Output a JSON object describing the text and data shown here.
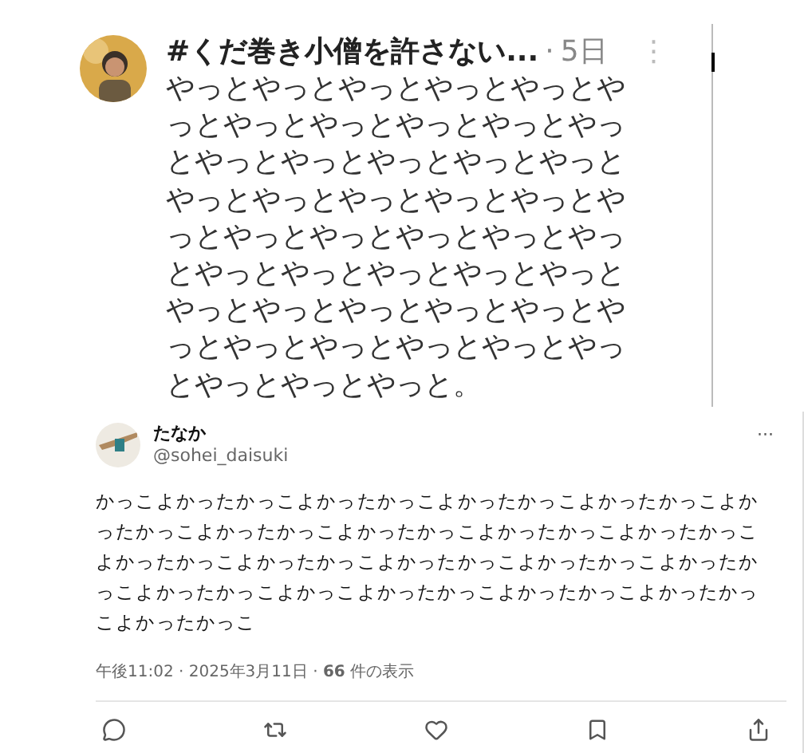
{
  "posts": [
    {
      "name": "#くだ巻き小僧を許さない...",
      "separator": "·",
      "time": "5日",
      "menu": "⋮",
      "text_lines": [
        "やっとやっとやっとやっとやっとや",
        "っとやっとやっとやっとやっとやっ",
        "とやっとやっとやっとやっとやっと",
        "やっとやっとやっとやっとやっとや",
        "っとやっとやっとやっとやっとやっ",
        "とやっとやっとやっとやっとやっと",
        "やっとやっとやっとやっとやっとや",
        "っとやっとやっとやっとやっとやっ",
        "とやっとやっとやっと。"
      ]
    },
    {
      "name": "たなか",
      "handle": "@sohei_daisuki",
      "menu": "···",
      "text_lines": [
        "かっこよかったかっこよかったかっこよかったかっこよかったかっこよか",
        "ったかっこよかったかっこよかったかっこよかったかっこよかったかっこ",
        "よかったかっこよかったかっこよかったかっこよかったかっこよかったか",
        "っこよかったかっこよかっこよかったかっこよかったかっこよかったかっ",
        "こよかったかっこ"
      ],
      "meta": "午後11:02 · 2025年3月11日 · **66** 件の表示"
    }
  ]
}
